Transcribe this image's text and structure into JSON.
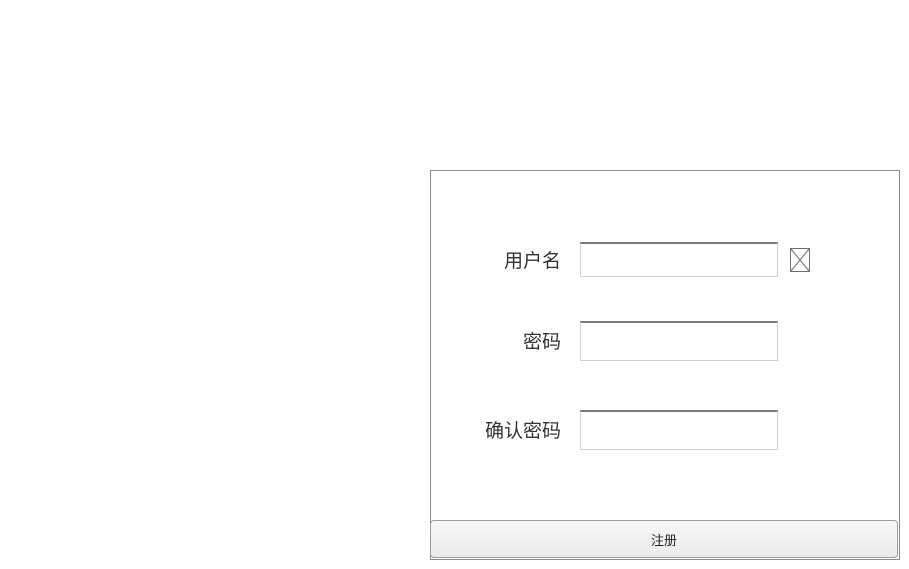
{
  "form": {
    "username": {
      "label": "用户名",
      "value": "",
      "placeholder": ""
    },
    "password": {
      "label": "密码",
      "value": "",
      "placeholder": ""
    },
    "confirm_password": {
      "label": "确认密码",
      "value": "",
      "placeholder": ""
    },
    "clear_icon": "broken-image-icon",
    "submit_label": "注册"
  },
  "colors": {
    "panel_border": "#8c8c8c",
    "label_text": "#333333",
    "button_bg": "#f0f0f0"
  }
}
